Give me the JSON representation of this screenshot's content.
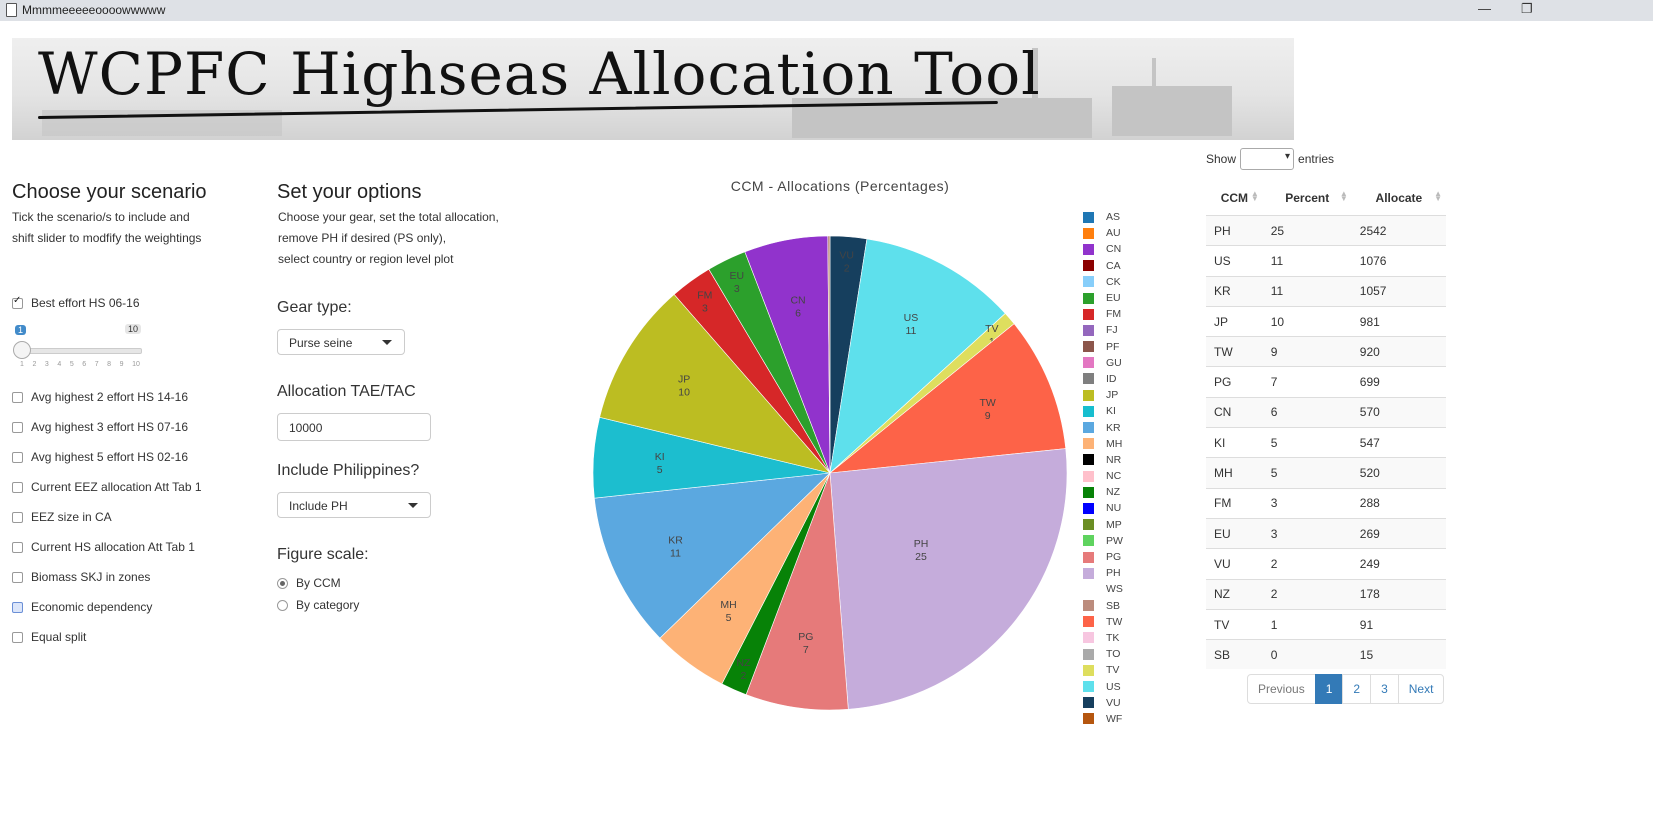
{
  "window": {
    "title": "Mmmmeeeeeoooowwwww",
    "minimize": "—",
    "restore": "❐"
  },
  "banner": {
    "title": "WCPFC Highseas Allocation Tool"
  },
  "scenario": {
    "heading": "Choose your scenario",
    "help_line1": "Tick the scenario/s to include and",
    "help_line2": "shift slider to modfify the weightings",
    "items": [
      {
        "label": "Best effort HS 06-16",
        "checked": true
      },
      {
        "label": "Avg highest 2 effort HS 14-16",
        "checked": false
      },
      {
        "label": "Avg highest 3 effort HS 07-16",
        "checked": false
      },
      {
        "label": "Avg highest 5 effort HS 02-16",
        "checked": false
      },
      {
        "label": "Current EEZ allocation Att Tab 1",
        "checked": false
      },
      {
        "label": "EEZ size in CA",
        "checked": false
      },
      {
        "label": "Current HS allocation Att Tab 1",
        "checked": false
      },
      {
        "label": "Biomass SKJ in zones",
        "checked": false
      },
      {
        "label": "Economic dependency",
        "checked": false
      },
      {
        "label": "Equal split",
        "checked": false
      }
    ],
    "slider": {
      "value": "1",
      "max": "10",
      "ticks": [
        "1",
        "2",
        "3",
        "4",
        "5",
        "6",
        "7",
        "8",
        "9",
        "10"
      ]
    }
  },
  "options": {
    "heading": "Set your options",
    "help_line1": "Choose your gear, set the total allocation,",
    "help_line2": "remove PH if desired (PS only),",
    "help_line3": "select country or region level plot",
    "gear_label": "Gear type:",
    "gear_value": "Purse seine",
    "alloc_label": "Allocation TAE/TAC",
    "alloc_value": "10000",
    "ph_label": "Include Philippines?",
    "ph_value": "Include PH",
    "scale_label": "Figure scale:",
    "scale_options": [
      "By CCM",
      "By category"
    ]
  },
  "chart_data": {
    "type": "pie",
    "title": "CCM - Allocations (Percentages)",
    "slices": [
      {
        "label": "VU",
        "value": 2.49,
        "pct": "2",
        "color": "#163f5e"
      },
      {
        "label": "US",
        "value": 10.76,
        "pct": "11",
        "color": "#5ee0ec"
      },
      {
        "label": "TV",
        "value": 0.91,
        "pct": "1",
        "color": "#dede5e"
      },
      {
        "label": "TW",
        "value": 9.2,
        "pct": "9",
        "color": "#fd6348"
      },
      {
        "label": "PH",
        "value": 25.42,
        "pct": "25",
        "color": "#c5acdb"
      },
      {
        "label": "PG",
        "value": 6.99,
        "pct": "7",
        "color": "#e67a7a"
      },
      {
        "label": "NZ",
        "value": 1.78,
        "pct": "2",
        "color": "#078207"
      },
      {
        "label": "MH",
        "value": 5.2,
        "pct": "5",
        "color": "#fdb276"
      },
      {
        "label": "KR",
        "value": 10.57,
        "pct": "11",
        "color": "#5ba8e0"
      },
      {
        "label": "KI",
        "value": 5.47,
        "pct": "5",
        "color": "#1cbecf"
      },
      {
        "label": "JP",
        "value": 9.81,
        "pct": "10",
        "color": "#bcbd22"
      },
      {
        "label": "FM",
        "value": 2.88,
        "pct": "3",
        "color": "#d62728"
      },
      {
        "label": "EU",
        "value": 2.69,
        "pct": "3",
        "color": "#2ca02c"
      },
      {
        "label": "CN",
        "value": 5.7,
        "pct": "6",
        "color": "#9133cc"
      },
      {
        "label": "SB",
        "value": 0.15,
        "pct": "0",
        "color": "#bc8c7d"
      }
    ],
    "legend_position": "right"
  },
  "legend": [
    {
      "code": "AS",
      "color": "#1f77b4"
    },
    {
      "code": "AU",
      "color": "#ff7f0e"
    },
    {
      "code": "CN",
      "color": "#9133cc"
    },
    {
      "code": "CA",
      "color": "#8b0000"
    },
    {
      "code": "CK",
      "color": "#87cefa"
    },
    {
      "code": "EU",
      "color": "#2ca02c"
    },
    {
      "code": "FM",
      "color": "#d62728"
    },
    {
      "code": "FJ",
      "color": "#9467bd"
    },
    {
      "code": "PF",
      "color": "#8c564b"
    },
    {
      "code": "GU",
      "color": "#e377c2"
    },
    {
      "code": "ID",
      "color": "#7f7f7f"
    },
    {
      "code": "JP",
      "color": "#bcbd22"
    },
    {
      "code": "KI",
      "color": "#17becf"
    },
    {
      "code": "KR",
      "color": "#5ba8e0"
    },
    {
      "code": "MH",
      "color": "#fdb276"
    },
    {
      "code": "NR",
      "color": "#000000"
    },
    {
      "code": "NC",
      "color": "#ffc0cb"
    },
    {
      "code": "NZ",
      "color": "#078207"
    },
    {
      "code": "NU",
      "color": "#0000ff"
    },
    {
      "code": "MP",
      "color": "#6b8e23"
    },
    {
      "code": "PW",
      "color": "#5fd35f"
    },
    {
      "code": "PG",
      "color": "#e67a7a"
    },
    {
      "code": "PH",
      "color": "#c5acdb"
    },
    {
      "code": "WS",
      "color": "#ffffff"
    },
    {
      "code": "SB",
      "color": "#bc8c7d"
    },
    {
      "code": "TW",
      "color": "#fd6348"
    },
    {
      "code": "TK",
      "color": "#f7c6e0"
    },
    {
      "code": "TO",
      "color": "#aaaaaa"
    },
    {
      "code": "TV",
      "color": "#dede5e"
    },
    {
      "code": "US",
      "color": "#5ee0ec"
    },
    {
      "code": "VU",
      "color": "#163f5e"
    },
    {
      "code": "WF",
      "color": "#b5560f"
    }
  ],
  "table": {
    "show_label": "Show",
    "entries_label": "entries",
    "columns": [
      "CCM",
      "Percent",
      "Allocate"
    ],
    "rows": [
      [
        "PH",
        "25",
        "2542"
      ],
      [
        "US",
        "11",
        "1076"
      ],
      [
        "KR",
        "11",
        "1057"
      ],
      [
        "JP",
        "10",
        "981"
      ],
      [
        "TW",
        "9",
        "920"
      ],
      [
        "PG",
        "7",
        "699"
      ],
      [
        "CN",
        "6",
        "570"
      ],
      [
        "KI",
        "5",
        "547"
      ],
      [
        "MH",
        "5",
        "520"
      ],
      [
        "FM",
        "3",
        "288"
      ],
      [
        "EU",
        "3",
        "269"
      ],
      [
        "VU",
        "2",
        "249"
      ],
      [
        "NZ",
        "2",
        "178"
      ],
      [
        "TV",
        "1",
        "91"
      ],
      [
        "SB",
        "0",
        "15"
      ]
    ],
    "pager": {
      "previous": "Previous",
      "pages": [
        "1",
        "2",
        "3"
      ],
      "next": "Next"
    }
  }
}
